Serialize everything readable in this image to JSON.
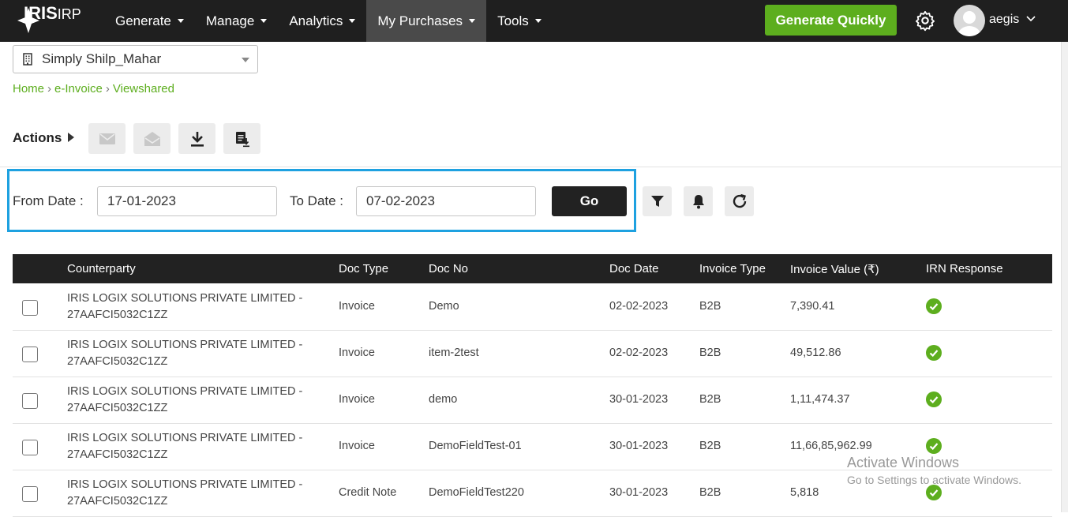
{
  "header": {
    "logo_main": "IRIS",
    "logo_sub": "IRP",
    "nav": [
      {
        "label": "Generate"
      },
      {
        "label": "Manage"
      },
      {
        "label": "Analytics"
      },
      {
        "label": "My Purchases"
      },
      {
        "label": "Tools"
      }
    ],
    "generate_quickly": "Generate Quickly",
    "user_name": "aegis"
  },
  "org_select": {
    "value": "Simply Shilp_Mahar"
  },
  "breadcrumb": [
    "Home",
    "e-Invoice",
    "Viewshared"
  ],
  "actions": {
    "label": "Actions"
  },
  "filters": {
    "from_label": "From Date :",
    "from_value": "17-01-2023",
    "to_label": "To Date :",
    "to_value": "07-02-2023",
    "go_label": "Go"
  },
  "table": {
    "columns": [
      "Counterparty",
      "Doc Type",
      "Doc No",
      "Doc Date",
      "Invoice Type",
      "Invoice Value (₹)",
      "IRN Response"
    ],
    "rows": [
      {
        "cp1": "IRIS LOGIX SOLUTIONS PRIVATE LIMITED -",
        "cp2": "27AAFCI5032C1ZZ",
        "doc_type": "Invoice",
        "doc_no": "Demo",
        "doc_date": "02-02-2023",
        "inv_type": "B2B",
        "value": "7,390.41"
      },
      {
        "cp1": "IRIS LOGIX SOLUTIONS PRIVATE LIMITED -",
        "cp2": "27AAFCI5032C1ZZ",
        "doc_type": "Invoice",
        "doc_no": "item-2test",
        "doc_date": "02-02-2023",
        "inv_type": "B2B",
        "value": "49,512.86"
      },
      {
        "cp1": "IRIS LOGIX SOLUTIONS PRIVATE LIMITED -",
        "cp2": "27AAFCI5032C1ZZ",
        "doc_type": "Invoice",
        "doc_no": "demo",
        "doc_date": "30-01-2023",
        "inv_type": "B2B",
        "value": "1,11,474.37"
      },
      {
        "cp1": "IRIS LOGIX SOLUTIONS PRIVATE LIMITED -",
        "cp2": "27AAFCI5032C1ZZ",
        "doc_type": "Invoice",
        "doc_no": "DemoFieldTest-01",
        "doc_date": "30-01-2023",
        "inv_type": "B2B",
        "value": "11,66,85,962.99"
      },
      {
        "cp1": "IRIS LOGIX SOLUTIONS PRIVATE LIMITED -",
        "cp2": "27AAFCI5032C1ZZ",
        "doc_type": "Credit Note",
        "doc_no": "DemoFieldTest220",
        "doc_date": "30-01-2023",
        "inv_type": "B2B",
        "value": "5,818"
      }
    ]
  },
  "watermark": {
    "line1": "Activate Windows",
    "line2": "Go to Settings to activate Windows."
  },
  "colors": {
    "topbar": "#1f1f1f",
    "accent_green": "#5dae1e",
    "highlight_blue": "#1ea1e0",
    "table_header": "#222222",
    "ok_green": "#5dae1e"
  }
}
